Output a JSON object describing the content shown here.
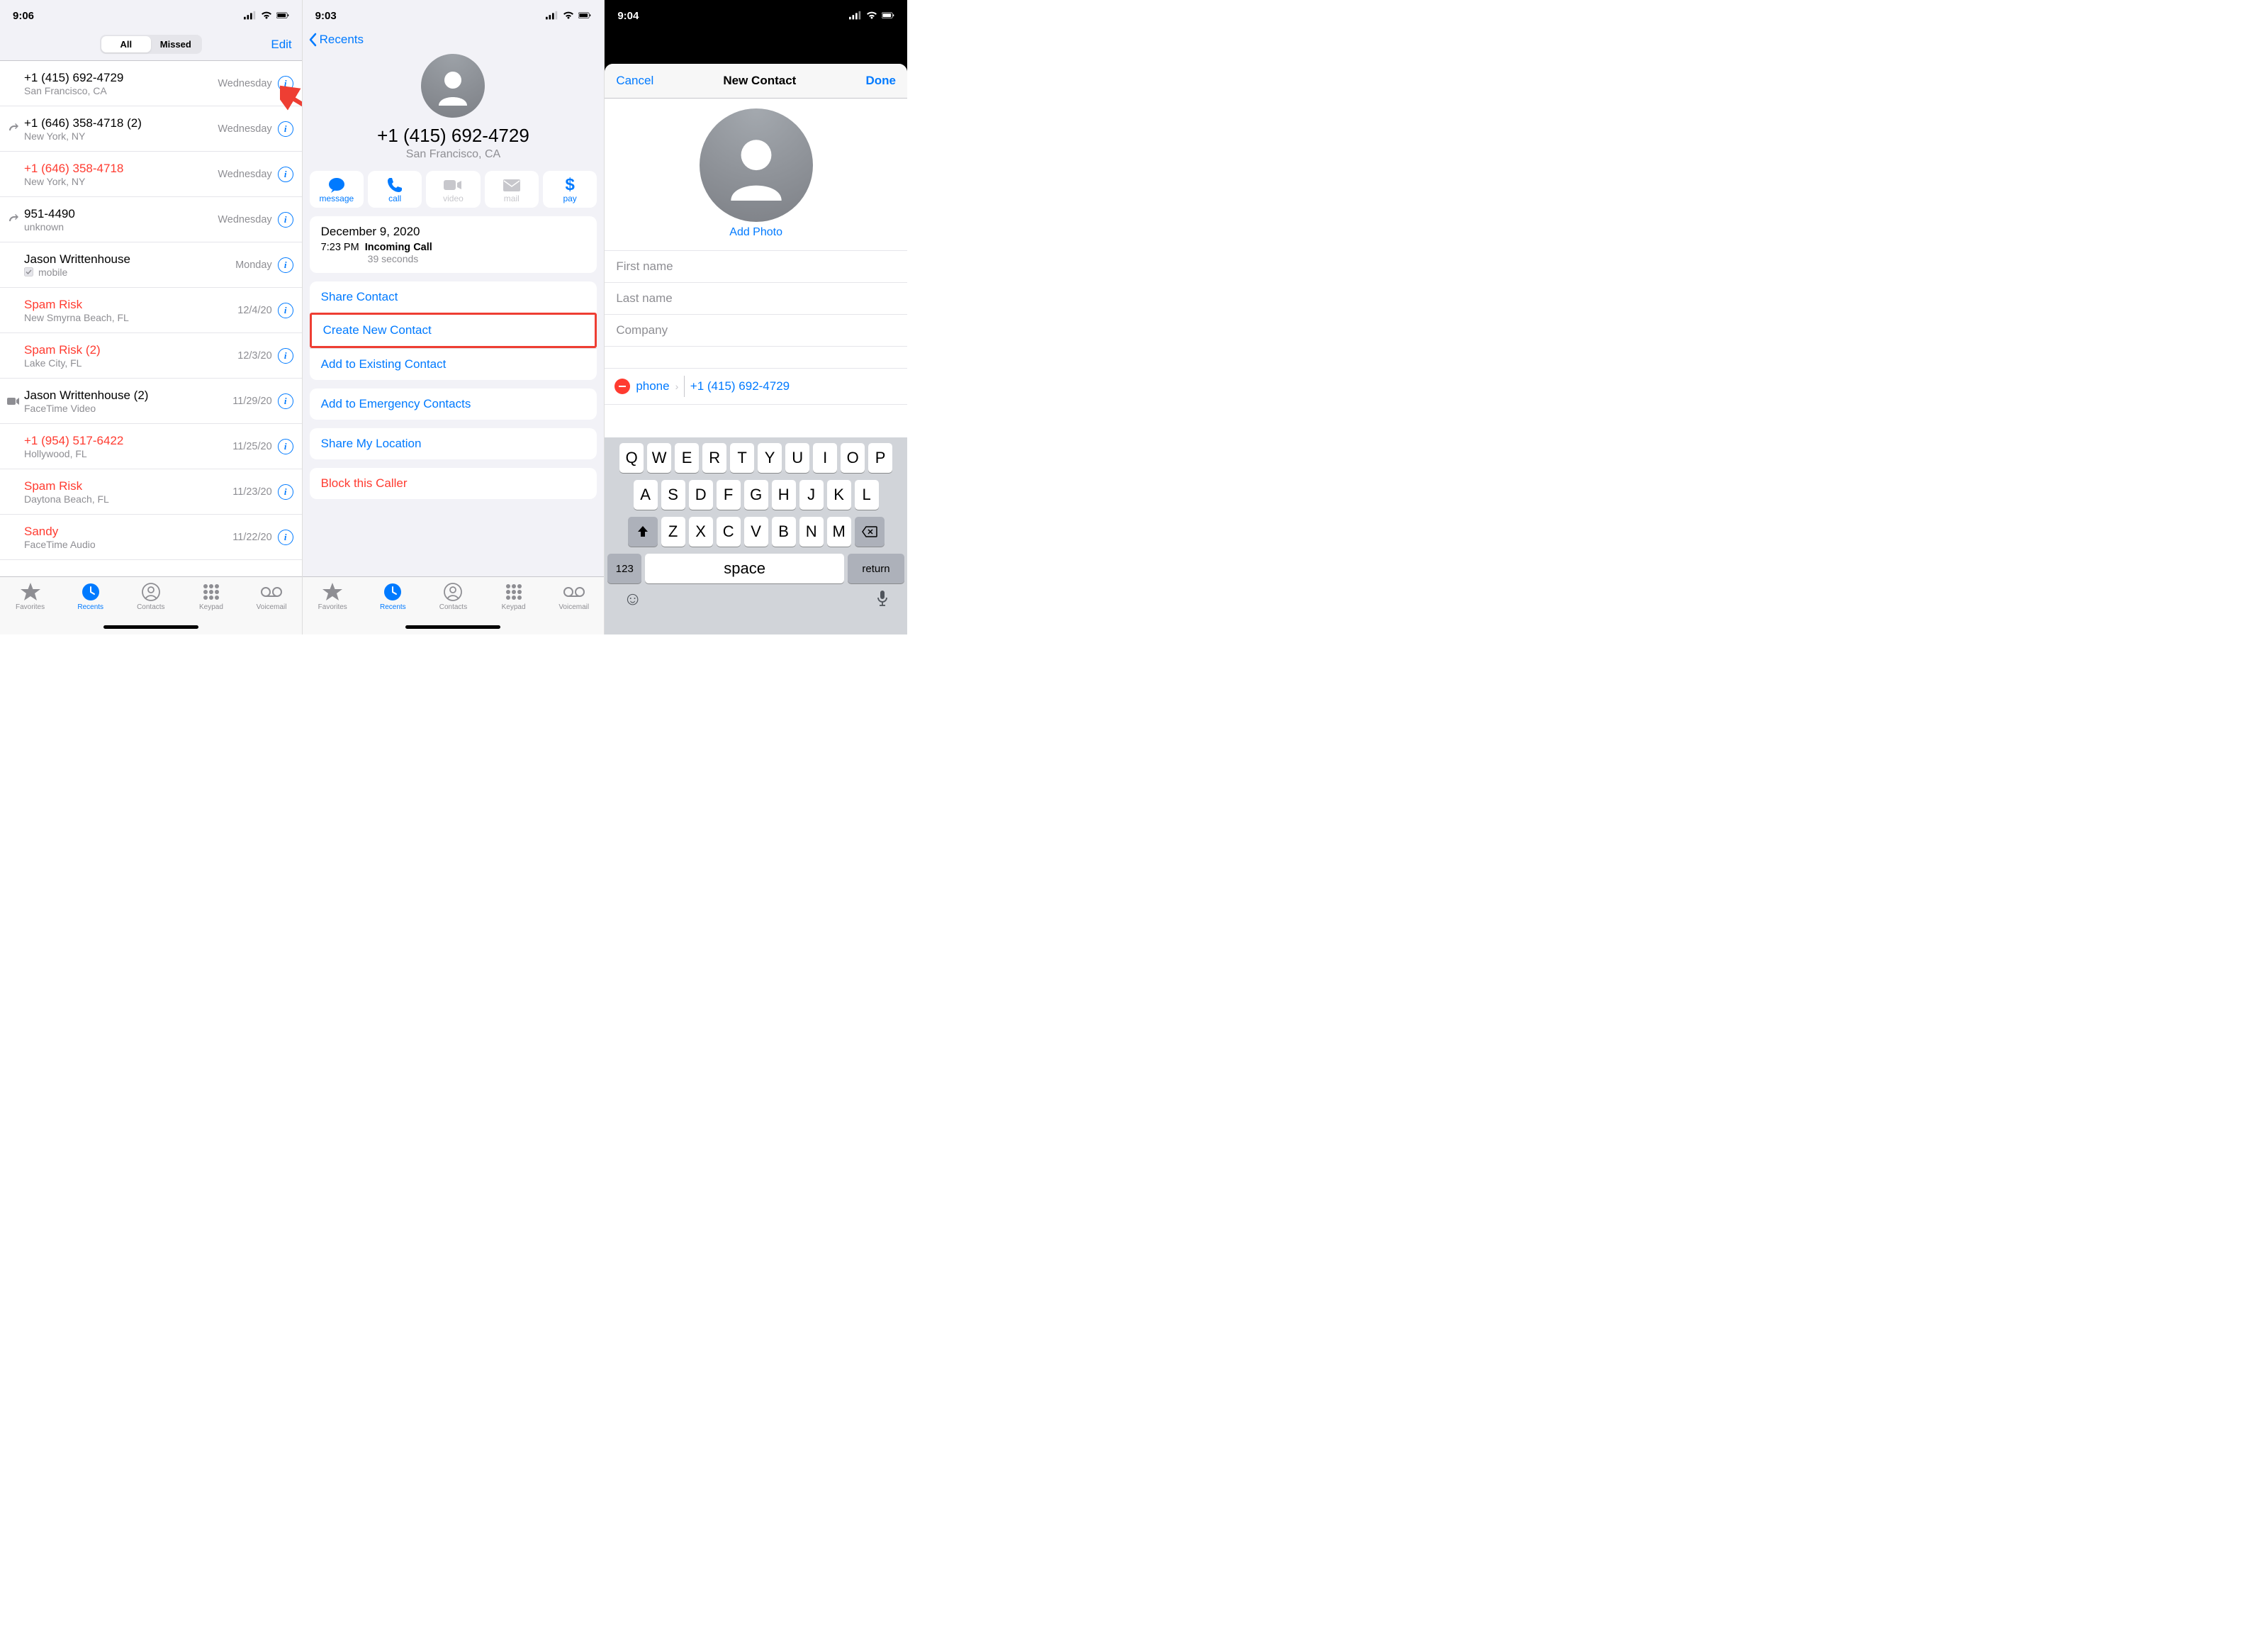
{
  "screen1": {
    "time": "9:06",
    "segments": {
      "all": "All",
      "missed": "Missed",
      "edit": "Edit"
    },
    "recents": [
      {
        "name": "+1 (415) 692-4729",
        "sub": "San Francisco, CA",
        "date": "Wednesday",
        "missed": false,
        "leftIcon": ""
      },
      {
        "name": "+1 (646) 358-4718 (2)",
        "sub": "New York, NY",
        "date": "Wednesday",
        "missed": false,
        "leftIcon": "out"
      },
      {
        "name": "+1 (646) 358-4718",
        "sub": "New York, NY",
        "date": "Wednesday",
        "missed": true,
        "leftIcon": ""
      },
      {
        "name": "951-4490",
        "sub": "unknown",
        "date": "Wednesday",
        "missed": false,
        "leftIcon": "out"
      },
      {
        "name": "Jason Writtenhouse",
        "sub": "mobile",
        "date": "Monday",
        "missed": false,
        "leftIcon": "",
        "checkbox": true
      },
      {
        "name": "Spam Risk",
        "sub": "New Smyrna Beach, FL",
        "date": "12/4/20",
        "missed": true,
        "leftIcon": ""
      },
      {
        "name": "Spam Risk (2)",
        "sub": "Lake City, FL",
        "date": "12/3/20",
        "missed": true,
        "leftIcon": ""
      },
      {
        "name": "Jason Writtenhouse (2)",
        "sub": "FaceTime Video",
        "date": "11/29/20",
        "missed": false,
        "leftIcon": "ft"
      },
      {
        "name": "+1 (954) 517-6422",
        "sub": "Hollywood, FL",
        "date": "11/25/20",
        "missed": true,
        "leftIcon": ""
      },
      {
        "name": "Spam Risk",
        "sub": "Daytona Beach, FL",
        "date": "11/23/20",
        "missed": true,
        "leftIcon": ""
      },
      {
        "name": "Sandy",
        "sub": "FaceTime Audio",
        "date": "11/22/20",
        "missed": true,
        "leftIcon": ""
      }
    ],
    "tabs": [
      {
        "label": "Favorites",
        "icon": "star"
      },
      {
        "label": "Recents",
        "icon": "clock",
        "active": true
      },
      {
        "label": "Contacts",
        "icon": "person"
      },
      {
        "label": "Keypad",
        "icon": "keypad"
      },
      {
        "label": "Voicemail",
        "icon": "voicemail"
      }
    ]
  },
  "screen2": {
    "time": "9:03",
    "back": "Recents",
    "phone": "+1 (415) 692-4729",
    "loc": "San Francisco, CA",
    "actions": [
      {
        "label": "message",
        "enabled": true
      },
      {
        "label": "call",
        "enabled": true
      },
      {
        "label": "video",
        "enabled": false
      },
      {
        "label": "mail",
        "enabled": false
      },
      {
        "label": "pay",
        "enabled": true
      }
    ],
    "callLog": {
      "date": "December 9, 2020",
      "time": "7:23 PM",
      "type": "Incoming Call",
      "duration": "39 seconds"
    },
    "rows1": [
      "Share Contact",
      "Create New Contact",
      "Add to Existing Contact"
    ],
    "rows2": [
      "Add to Emergency Contacts"
    ],
    "rows3": [
      "Share My Location"
    ],
    "rows4": [
      "Block this Caller"
    ]
  },
  "screen3": {
    "time": "9:04",
    "cancel": "Cancel",
    "title": "New Contact",
    "done": "Done",
    "addPhoto": "Add Photo",
    "fields": {
      "first": "First name",
      "last": "Last name",
      "company": "Company"
    },
    "phoneLabel": "phone",
    "phoneValue": "+1 (415) 692-4729",
    "keyboard": {
      "row1": [
        "Q",
        "W",
        "E",
        "R",
        "T",
        "Y",
        "U",
        "I",
        "O",
        "P"
      ],
      "row2": [
        "A",
        "S",
        "D",
        "F",
        "G",
        "H",
        "J",
        "K",
        "L"
      ],
      "row3": [
        "Z",
        "X",
        "C",
        "V",
        "B",
        "N",
        "M"
      ],
      "numKey": "123",
      "space": "space",
      "return": "return"
    }
  }
}
